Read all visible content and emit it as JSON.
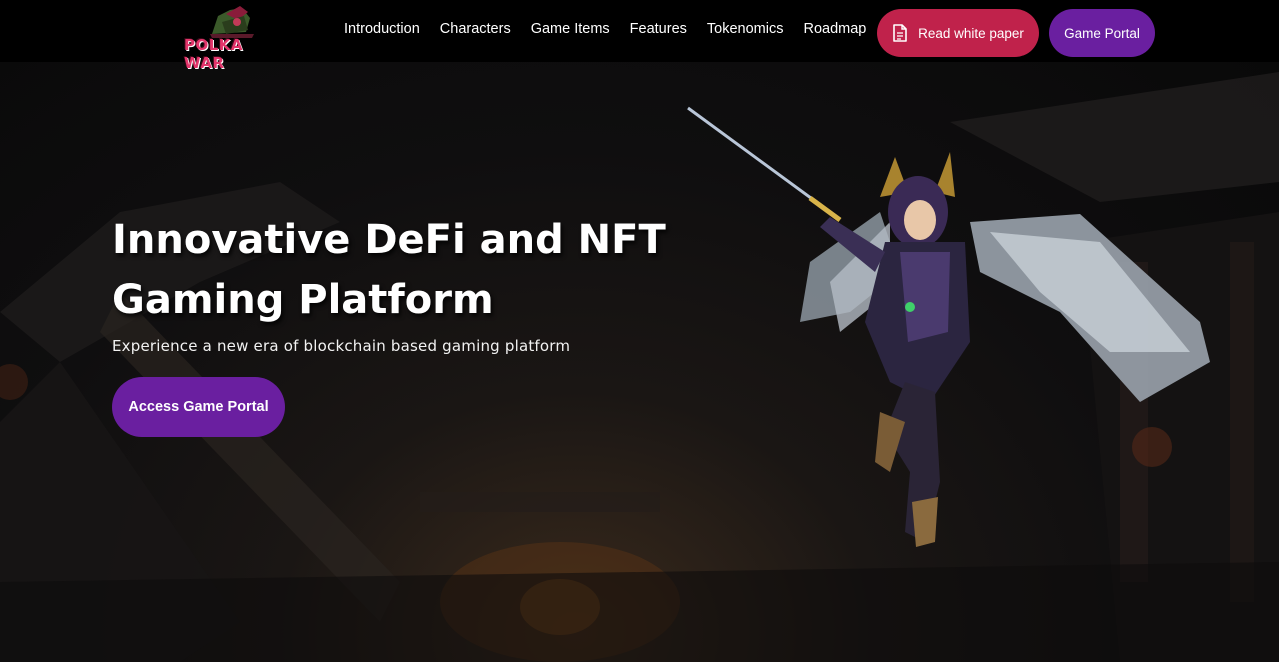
{
  "brand": {
    "logo_text": "POLKA WAR"
  },
  "nav": {
    "items": [
      {
        "label": "Introduction"
      },
      {
        "label": "Characters"
      },
      {
        "label": "Game Items"
      },
      {
        "label": "Features"
      },
      {
        "label": "Tokenomics"
      },
      {
        "label": "Roadmap"
      }
    ],
    "white_paper_label": "Read white paper",
    "game_portal_label": "Game Portal"
  },
  "hero": {
    "title": "Innovative DeFi and NFT Gaming Platform",
    "subtitle": "Experience a new era of blockchain based gaming platform",
    "cta_label": "Access Game Portal"
  },
  "colors": {
    "white_paper_button": "#c0224b",
    "game_portal_button": "#6a1fa0",
    "logo_accent": "#e2356b",
    "background": "#000000"
  },
  "icons": {
    "white_paper": "document-icon",
    "hero_art": "winged-warrior-character"
  }
}
